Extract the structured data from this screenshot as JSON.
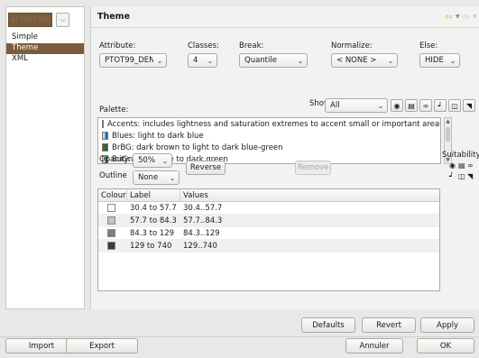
{
  "left": {
    "filter_placeholder": "er text here",
    "items": [
      {
        "label": "Simple",
        "selected": false
      },
      {
        "label": "Theme",
        "selected": true
      },
      {
        "label": "XML",
        "selected": false
      }
    ]
  },
  "header": {
    "title": "Theme"
  },
  "fields": {
    "attribute_label": "Attribute:",
    "attribute_value": "PTOT99_DEN",
    "classes_label": "Classes:",
    "classes_value": "4",
    "break_label": "Break:",
    "break_value": "Quantile",
    "normalize_label": "Normalize:",
    "normalize_value": "< NONE >",
    "else_label": "Else:",
    "else_value": "HIDE"
  },
  "palette": {
    "label": "Palette:",
    "show_label": "Show:",
    "show_value": "All",
    "items": [
      {
        "text": "Accents: includes lightness and saturation extremes to accent small or important areas",
        "colors": [
          "#7fc97f",
          "#e63946"
        ]
      },
      {
        "text": "Blues: light to dark blue",
        "colors": [
          "#c6dbef",
          "#2171b5"
        ]
      },
      {
        "text": "BrBG: dark brown to light to dark blue-green",
        "colors": [
          "#8c510a",
          "#01665e"
        ]
      },
      {
        "text": "BuGn: light blue to dark green",
        "colors": [
          "#e5f5f9",
          "#238b45"
        ]
      }
    ]
  },
  "opacity": {
    "label": "Opacity:",
    "value": "50%"
  },
  "outline": {
    "label": "Outline",
    "value": "None"
  },
  "buttons": {
    "reverse": "Reverse",
    "remove": "Remove",
    "defaults": "Defaults",
    "revert": "Revert",
    "apply": "Apply",
    "import": "Import",
    "export": "Export",
    "cancel": "Annuler",
    "ok": "OK"
  },
  "suitability_label": "Suitability:",
  "table": {
    "headers": [
      "Colour",
      "Label",
      "Values"
    ],
    "rows": [
      {
        "color": "#ffffff",
        "label": "30.4 to 57.7",
        "values": "30.4..57.7"
      },
      {
        "color": "#c2c2c2",
        "label": "57.7 to 84.3",
        "values": "57.7..84.3"
      },
      {
        "color": "#7d7d7d",
        "label": "84.3 to 129",
        "values": "84.3..129"
      },
      {
        "color": "#3a3a3a",
        "label": "129 to 740",
        "values": "129..740"
      }
    ]
  },
  "colors": {
    "selection": "#7a5c3a",
    "nav_arrow": "#e9a21b"
  }
}
